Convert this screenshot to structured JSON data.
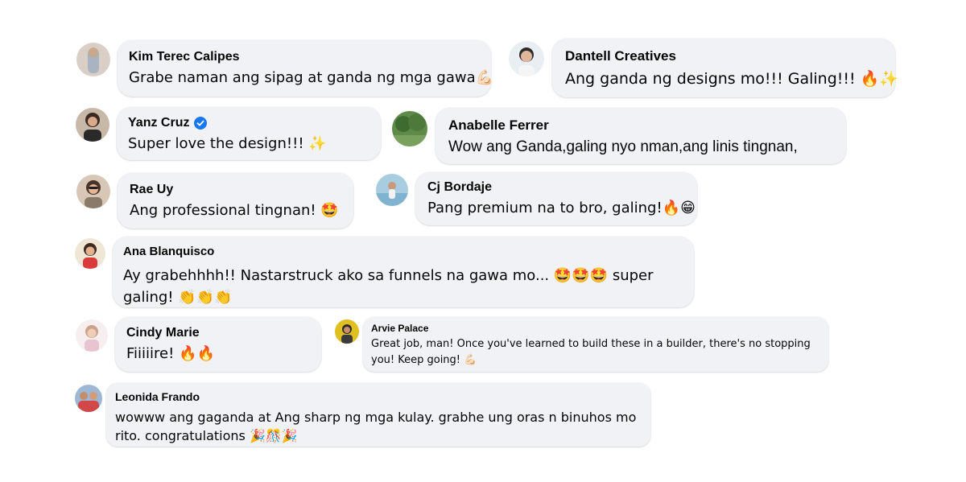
{
  "comments": [
    {
      "name": "Kim Terec Calipes",
      "text": "Grabe naman ang sipag at ganda ng mga gawa💪🏻",
      "verified": false
    },
    {
      "name": "Dantell Creatives",
      "text": "Ang ganda ng designs mo!!! Galing!!! 🔥✨",
      "verified": false
    },
    {
      "name": "Yanz Cruz",
      "text": "Super love the design!!! ✨",
      "verified": true
    },
    {
      "name": "Anabelle Ferrer",
      "text": "Wow ang Ganda,galing nyo nman,ang linis tingnan,",
      "verified": false
    },
    {
      "name": "Rae Uy",
      "text": "Ang professional tingnan! 🤩",
      "verified": false
    },
    {
      "name": "Cj Bordaje",
      "text": "Pang premium na to bro, galing!🔥😁",
      "verified": false
    },
    {
      "name": "Ana Blanquisco",
      "text": "Ay grabehhhh!! Nastarstruck ako sa funnels na gawa mo... 🤩🤩🤩 super galing! 👏👏👏",
      "verified": false
    },
    {
      "name": "Cindy Marie",
      "text": "Fiiiiire! 🔥🔥",
      "verified": false
    },
    {
      "name": "Arvie Palace",
      "text": "Great job, man! Once you've learned to build these in a builder, there's no stopping you! Keep going! 💪🏻",
      "verified": false
    },
    {
      "name": "Leonida Frando",
      "text": "wowww ang gaganda at Ang sharp ng mga kulay. grabhe ung oras n binuhos mo rito. congratulations 🎉🎊🎉",
      "verified": false
    }
  ]
}
